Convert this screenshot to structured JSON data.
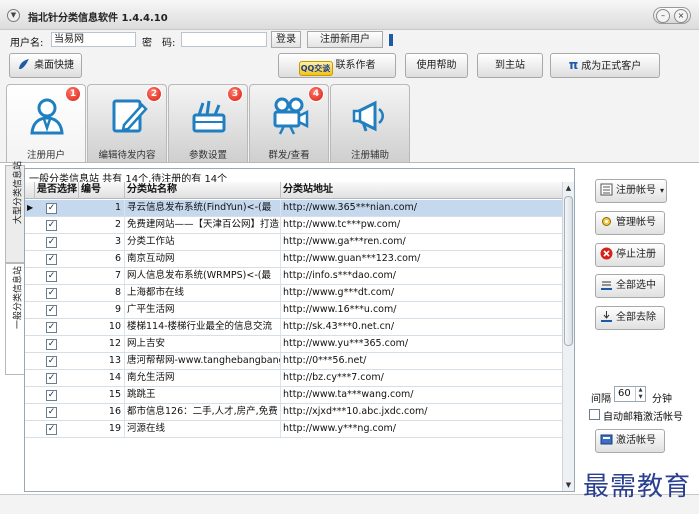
{
  "window": {
    "title": "指北针分类信息软件 1.4.4.10"
  },
  "login": {
    "username_label": "用户名:",
    "username_value": "当易网",
    "password_label": "密　码:",
    "password_value": "",
    "login_button": "登录",
    "register_button": "注册新用户"
  },
  "toolbar": {
    "desktop_shortcut": "桌面快捷",
    "qq_badge": "QQ交谈",
    "contact_author": "联系作者",
    "help": "使用帮助",
    "to_main_site": "到主站",
    "become_member_symbol": "π",
    "become_member": "成为正式客户"
  },
  "tabs": [
    {
      "label": "注册用户",
      "badge": "1"
    },
    {
      "label": "编辑待发内容",
      "badge": "2"
    },
    {
      "label": "参数设置",
      "badge": "3"
    },
    {
      "label": "群发/查看",
      "badge": "4"
    },
    {
      "label": "注册辅助",
      "badge": ""
    }
  ],
  "side_tabs": [
    {
      "label": "大型分类信息站"
    },
    {
      "label": "一般分类信息站"
    }
  ],
  "grid": {
    "summary": "一般分类信息站 共有 14个,待注册的有 14个",
    "columns": [
      "是否选择",
      "编号",
      "分类站名称",
      "分类站地址"
    ],
    "rows": [
      {
        "checked": true,
        "id": "1",
        "name": "寻云信息发布系统(FindYun)<-(最",
        "url": "http://www.365***nian.com/"
      },
      {
        "checked": true,
        "id": "2",
        "name": "免费建网站——【天津百公网】打造",
        "url": "http://www.tc***pw.com/"
      },
      {
        "checked": true,
        "id": "3",
        "name": "分类工作站",
        "url": "http://www.ga***ren.com/"
      },
      {
        "checked": true,
        "id": "6",
        "name": "南京互动网",
        "url": "http://www.guan***123.com/"
      },
      {
        "checked": true,
        "id": "7",
        "name": "网人信息发布系统(WRMPS)<-(最",
        "url": "http://info.s***dao.com/"
      },
      {
        "checked": true,
        "id": "8",
        "name": "上海都市在线",
        "url": "http://www.g***dt.com/"
      },
      {
        "checked": true,
        "id": "9",
        "name": "广平生活网",
        "url": "http://www.16***u.com/"
      },
      {
        "checked": true,
        "id": "10",
        "name": "楼梯114-楼梯行业最全的信息交流",
        "url": "http://sk.43***0.net.cn/"
      },
      {
        "checked": true,
        "id": "12",
        "name": "网上吉安",
        "url": "http://www.yu***365.com/"
      },
      {
        "checked": true,
        "id": "13",
        "name": "唐河帮帮网-www.tanghebangbang",
        "url": "http://0***56.net/"
      },
      {
        "checked": true,
        "id": "14",
        "name": "南允生活网",
        "url": "http://bz.cy***7.com/"
      },
      {
        "checked": true,
        "id": "15",
        "name": "跳跳王",
        "url": "http://www.ta***wang.com/"
      },
      {
        "checked": true,
        "id": "16",
        "name": "都市信息126：二手,人才,房产,免费",
        "url": "http://xjxd***10.abc.jxdc.com/"
      },
      {
        "checked": true,
        "id": "19",
        "name": "河源在线",
        "url": "http://www.y***ng.com/"
      }
    ]
  },
  "actions": {
    "register_account": "注册帐号",
    "manage_account": "管理帐号",
    "stop_register": "停止注册",
    "select_all": "全部选中",
    "deselect_all": "全部去除",
    "interval_label": "间隔",
    "interval_value": "60",
    "interval_unit": "分钟",
    "auto_activate_label": "自动邮箱激活帐号",
    "activate_account": "激活帐号"
  },
  "watermark": "最需教育"
}
